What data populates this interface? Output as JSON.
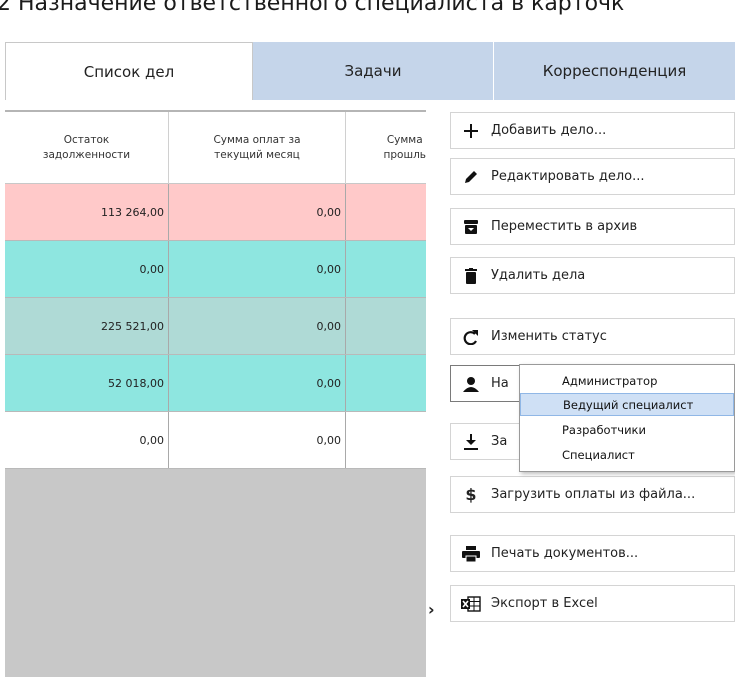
{
  "doc_heading": ".2 Назначение ответственного специалиста в карточк",
  "tabs": [
    {
      "label": "Список дел",
      "active": true
    },
    {
      "label": "Задачи",
      "active": false
    },
    {
      "label": "Корреспонденция",
      "active": false
    }
  ],
  "table": {
    "columns": [
      "Остаток\nзадолженности",
      "Сумма оплат за\nтекущий месяц",
      "Сумма\nпрошль"
    ],
    "rows": [
      {
        "debt": "113 264,00",
        "current": "0,00",
        "color": "#ffc9c9"
      },
      {
        "debt": "0,00",
        "current": "0,00",
        "color": "#8ee6e0"
      },
      {
        "debt": "225 521,00",
        "current": "0,00",
        "color": "#afdad6"
      },
      {
        "debt": "52 018,00",
        "current": "0,00",
        "color": "#8ee6e0"
      },
      {
        "debt": "0,00",
        "current": "0,00",
        "color": "#ffffff"
      }
    ],
    "empty_bg": "#c8c8c8"
  },
  "actions": {
    "add": "Добавить дело...",
    "edit": "Редактировать дело...",
    "archive": "Переместить в архив",
    "delete": "Удалить дела",
    "status": "Изменить статус",
    "assign": "На",
    "load": "За",
    "payments": "Загрузить оплаты из файла...",
    "print": "Печать документов...",
    "excel": "Экспорт в Excel"
  },
  "assign_menu": {
    "items": [
      "Администратор",
      "Ведущий специалист",
      "Разработчики",
      "Специалист"
    ],
    "highlighted": "Ведущий специалист"
  },
  "colors": {
    "tab_inactive": "#c5d5ea",
    "menu_highlight": "#cfe0f5"
  }
}
